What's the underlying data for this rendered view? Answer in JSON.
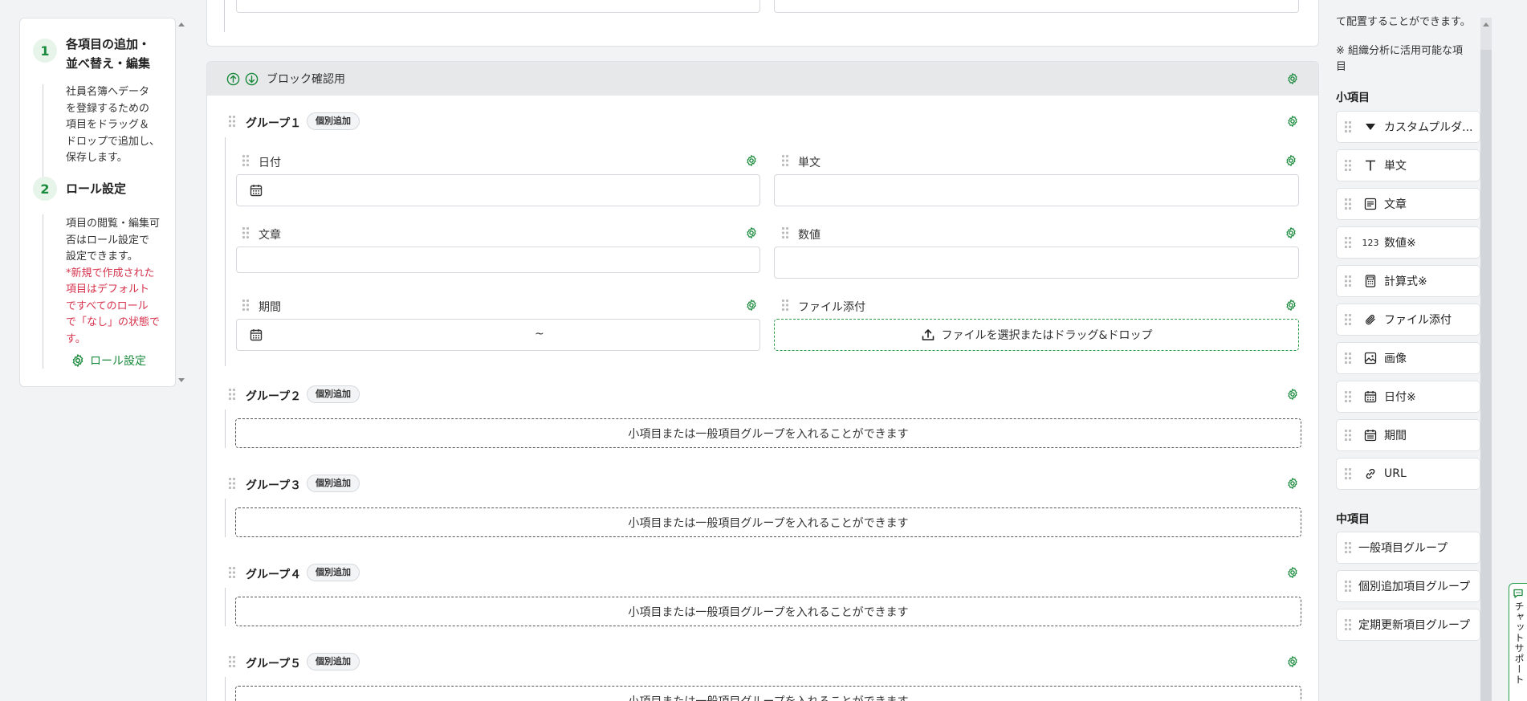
{
  "steps": [
    {
      "num": "1",
      "title_line1": "各項目の追加・",
      "title_line2": "並べ替え・編集",
      "body": [
        "社員名簿へデータ",
        "を登録するための",
        "項目をドラッグ＆",
        "ドロップで追加し、",
        "保存します。"
      ]
    },
    {
      "num": "2",
      "title_line1": "ロール設定",
      "body": [
        "項目の閲覧・編集可",
        "否はロール設定で",
        "設定できます。"
      ],
      "warn": [
        "*新規で作成された",
        "項目はデフォルト",
        "ですべてのロール",
        "で「なし」の状態で",
        "す。"
      ],
      "link": "ロール設定"
    }
  ],
  "block": {
    "title": "ブロック確認用",
    "groups": [
      {
        "label": "グループ１",
        "badge": "個別追加"
      },
      {
        "label": "グループ２",
        "badge": "個別追加",
        "dropzone": "小項目または一般項目グループを入れることができます"
      },
      {
        "label": "グループ３",
        "badge": "個別追加",
        "dropzone": "小項目または一般項目グループを入れることができます"
      },
      {
        "label": "グループ４",
        "badge": "個別追加",
        "dropzone": "小項目または一般項目グループを入れることができます"
      },
      {
        "label": "グループ５",
        "badge": "個別追加",
        "dropzone": "小項目または一般項目グループを入れることができます"
      }
    ],
    "fields": {
      "date": "日付",
      "short_text": "単文",
      "long_text": "文章",
      "number": "数値",
      "period": "期間",
      "period_sep": "~",
      "file": "ファイル添付",
      "file_zone": "ファイルを選択またはドラッグ&ドロップ"
    }
  },
  "palette": {
    "note_top": "て配置することができます。",
    "note": [
      "※ 組織分析に活用可能な項",
      "目"
    ],
    "small_title": "小項目",
    "small_items": [
      "カスタムプルダ...",
      "単文",
      "文章",
      "数値※",
      "計算式※",
      "ファイル添付",
      "画像",
      "日付※",
      "期間",
      "URL"
    ],
    "number_icon": "123",
    "medium_title": "中項目",
    "medium_items": [
      "一般項目グループ",
      "個別追加項目グループ",
      "定期更新項目グループ"
    ]
  },
  "chat": {
    "label": "チャットサポート"
  },
  "colors": {
    "accent": "#1a8a3c",
    "warn": "#d6334d"
  }
}
